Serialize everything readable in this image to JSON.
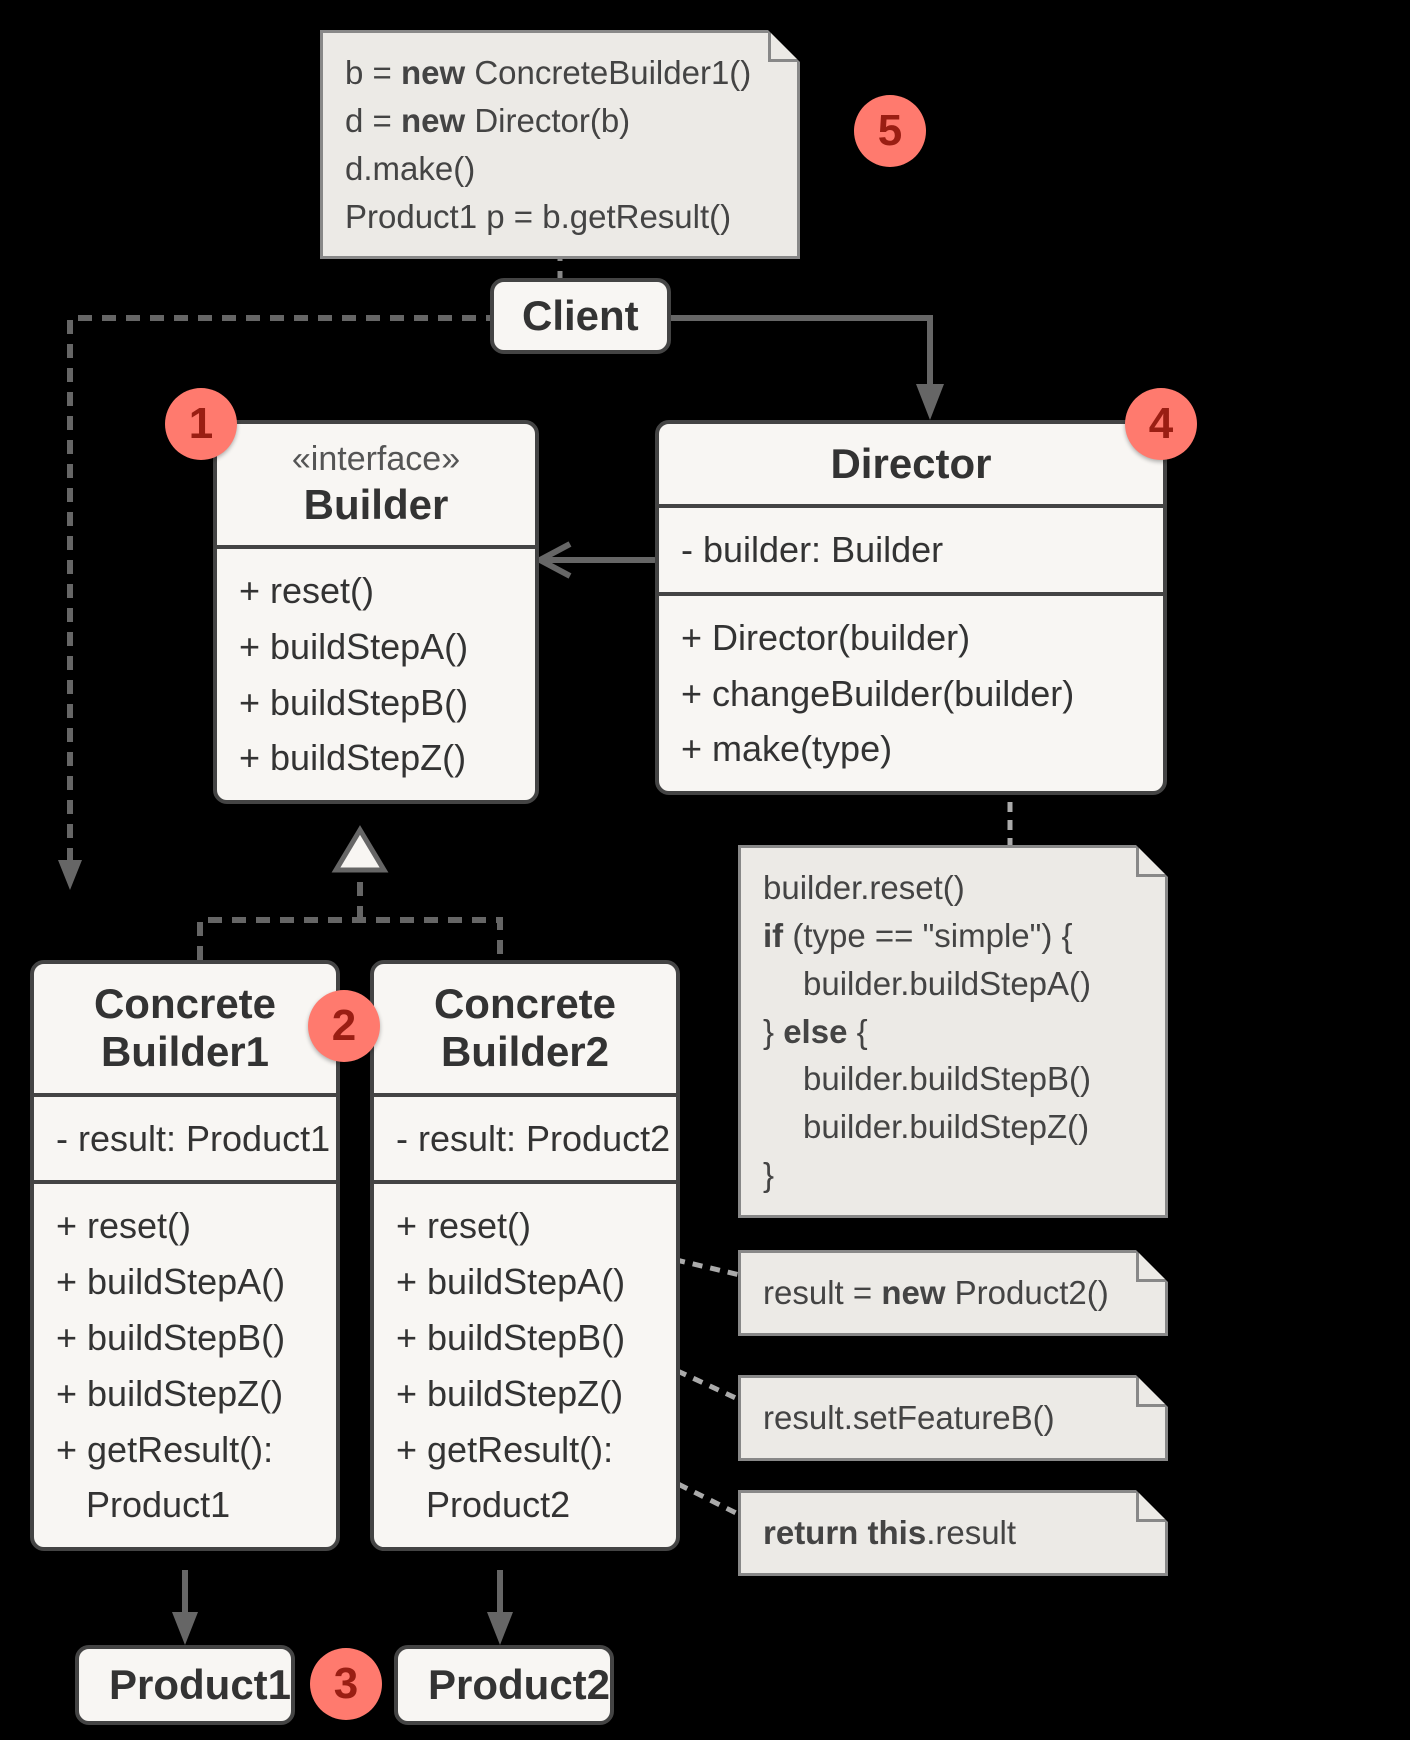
{
  "note_top": {
    "lines": [
      {
        "t": "b = ",
        "bold": "new",
        "after": " ConcreteBuilder1()"
      },
      {
        "t": "d = ",
        "bold": "new",
        "after": " Director(b)"
      },
      {
        "t": "d.make()"
      },
      {
        "t": "Product1 p = b.getResult()"
      }
    ]
  },
  "client": "Client",
  "builder": {
    "stereo": "«interface»",
    "name": "Builder",
    "methods": [
      "+ reset()",
      "+ buildStepA()",
      "+ buildStepB()",
      "+ buildStepZ()"
    ]
  },
  "director": {
    "name": "Director",
    "fields": [
      "- builder: Builder"
    ],
    "methods": [
      "+ Director(builder)",
      "+ changeBuilder(builder)",
      "+ make(type)"
    ]
  },
  "note_make": {
    "lines": [
      "builder.reset()",
      {
        "bold": "if",
        "after": " (type == \"simple\") {"
      },
      {
        "indent": "builder.buildStepA()"
      },
      {
        "t": "} ",
        "bold": "else",
        "after": " {"
      },
      {
        "indent": "builder.buildStepB()"
      },
      {
        "indent": "builder.buildStepZ()"
      },
      "}"
    ]
  },
  "cb1": {
    "name1": "Concrete",
    "name2": "Builder1",
    "fields": [
      "- result: Product1"
    ],
    "methods": [
      "+ reset()",
      "+ buildStepA()",
      "+ buildStepB()",
      "+ buildStepZ()",
      "+ getResult():",
      "   Product1"
    ]
  },
  "cb2": {
    "name1": "Concrete",
    "name2": "Builder2",
    "fields": [
      "- result: Product2"
    ],
    "methods": [
      "+ reset()",
      "+ buildStepA()",
      "+ buildStepB()",
      "+ buildStepZ()",
      "+ getResult():",
      "   Product2"
    ]
  },
  "note_reset": {
    "t": "result = ",
    "bold": "new",
    "after": " Product2()"
  },
  "note_stepb": "result.setFeatureB()",
  "note_getresult": {
    "bold": "return this",
    "after": ".result"
  },
  "products": {
    "p1": "Product1",
    "p2": "Product2"
  },
  "badges": {
    "b1": "1",
    "b2": "2",
    "b3": "3",
    "b4": "4",
    "b5": "5"
  }
}
